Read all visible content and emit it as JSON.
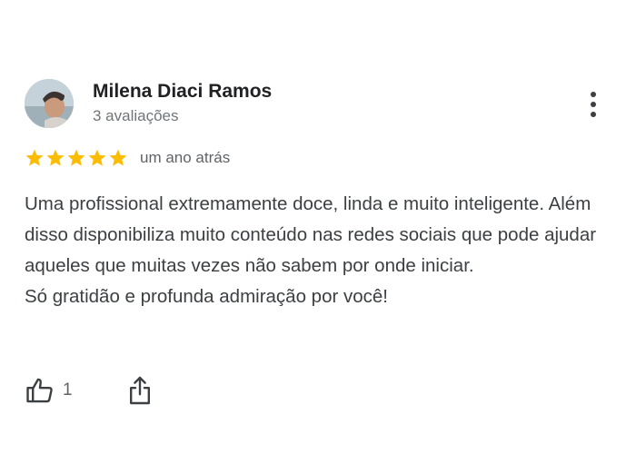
{
  "review": {
    "reviewer_name": "Milena Diaci Ramos",
    "review_count": "3 avaliações",
    "rating": 5,
    "rating_max": 5,
    "star_color": "#fbbc04",
    "date": "um ano atrás",
    "text_lines": [
      "Uma profissional extremamente doce, linda e muito inteligente. Além disso disponibiliza muito conteúdo nas redes sociais que pode ajudar aqueles que muitas vezes não sabem por onde iniciar.",
      "Só gratidão e profunda admiração por você!"
    ],
    "like_count": "1"
  },
  "icons": {
    "more": "more-vert-icon",
    "like": "thumbs-up-icon",
    "share": "share-icon"
  }
}
